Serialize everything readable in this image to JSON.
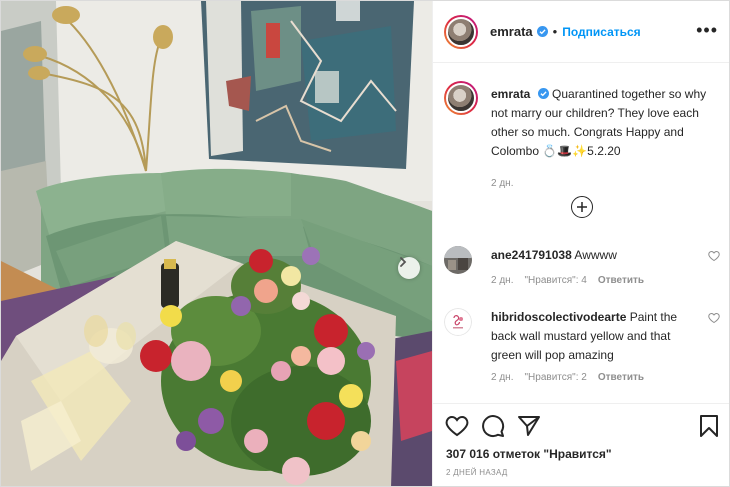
{
  "post": {
    "username": "emrata",
    "follow_label": "Подписаться",
    "more_label": "•••",
    "caption": {
      "text": "Quarantined together so why not marry our children? They love each other so much. Congrats Happy and Colombo 💍🎩✨5.2.20",
      "time": "2 дн."
    },
    "comments": [
      {
        "username": "ane241791038",
        "text": "Awwww",
        "time": "2 дн.",
        "likes": "\"Нравится\": 4",
        "reply": "Ответить"
      },
      {
        "username": "hibridoscolectivodearte",
        "text": "Paint the back wall mustard yellow and that green will pop amazing",
        "time": "2 дн.",
        "likes": "\"Нравится\": 2",
        "reply": "Ответить"
      }
    ],
    "likes_count": "307 016 отметок \"Нравится\"",
    "post_time": "2 дней назад"
  },
  "colors": {
    "link_blue": "#0095f6",
    "verified_blue": "#3897f0",
    "muted": "#8e8e8e",
    "text": "#262626"
  },
  "icons": [
    "verified-badge-icon",
    "more-options-icon",
    "load-more-comments-icon",
    "heart-icon",
    "comment-icon",
    "share-icon",
    "bookmark-icon",
    "next-photo-arrow-icon"
  ]
}
